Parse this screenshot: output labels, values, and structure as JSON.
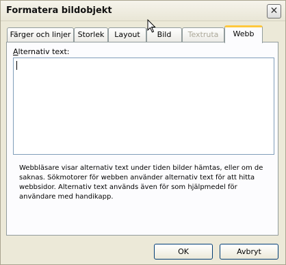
{
  "window": {
    "title": "Formatera bildobjekt"
  },
  "tabs": [
    {
      "label": "Färger och linjer",
      "state": "normal"
    },
    {
      "label": "Storlek",
      "state": "normal"
    },
    {
      "label": "Layout",
      "state": "normal"
    },
    {
      "label": "Bild",
      "state": "normal"
    },
    {
      "label": "Textruta",
      "state": "disabled"
    },
    {
      "label": "Webb",
      "state": "active"
    }
  ],
  "webb": {
    "alt_text_label_accesskey": "A",
    "alt_text_label_rest": "lternativ text:",
    "alt_text_value": "",
    "description": "Webbläsare visar alternativ text under tiden bilder hämtas, eller om de saknas. Sökmotorer för webben använder alternativ text för att hitta webbsidor. Alternativ text används även för som hjälpmedel för användare med handikapp."
  },
  "buttons": {
    "ok": "OK",
    "cancel": "Avbryt"
  },
  "icons": {
    "close": "close-icon",
    "pointer": "mouse-pointer-icon"
  },
  "colors": {
    "active_tab_accent": "#ffc83c",
    "disabled_text": "#aca899"
  }
}
